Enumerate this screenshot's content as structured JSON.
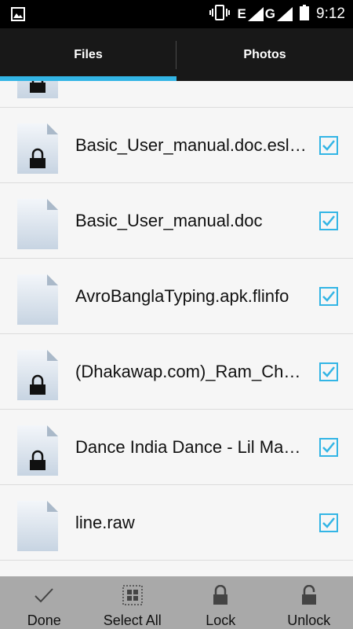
{
  "status_bar": {
    "left_icon": "image-icon",
    "vibrate_icon": "vibrate-icon",
    "network_a": "E",
    "network_b": "G",
    "battery_icon": "battery-icon",
    "time": "9:12"
  },
  "tabs": [
    {
      "label": "Files",
      "active": true
    },
    {
      "label": "Photos",
      "active": false
    }
  ],
  "files": [
    {
      "name": "",
      "locked": true,
      "checked": true
    },
    {
      "name": "Basic_User_manual.doc.esl…",
      "locked": true,
      "checked": true
    },
    {
      "name": "Basic_User_manual.doc",
      "locked": false,
      "checked": true
    },
    {
      "name": "AvroBanglaTyping.apk.flinfo",
      "locked": false,
      "checked": true
    },
    {
      "name": "(Dhakawap.com)_Ram_Ch…",
      "locked": true,
      "checked": true
    },
    {
      "name": " Dance India Dance - Lil Ma…",
      "locked": true,
      "checked": true
    },
    {
      "name": "line.raw",
      "locked": false,
      "checked": true
    }
  ],
  "colors": {
    "accent": "#33b5e5",
    "tab_bar": "#181818",
    "bottom_bar": "#a9a9a9",
    "list_bg": "#f6f6f6"
  },
  "bottom_actions": [
    {
      "label": "Done",
      "icon": "checkmark-icon"
    },
    {
      "label": "Select All",
      "icon": "select-all-icon"
    },
    {
      "label": "Lock",
      "icon": "lock-icon"
    },
    {
      "label": "Unlock",
      "icon": "unlock-icon"
    }
  ]
}
